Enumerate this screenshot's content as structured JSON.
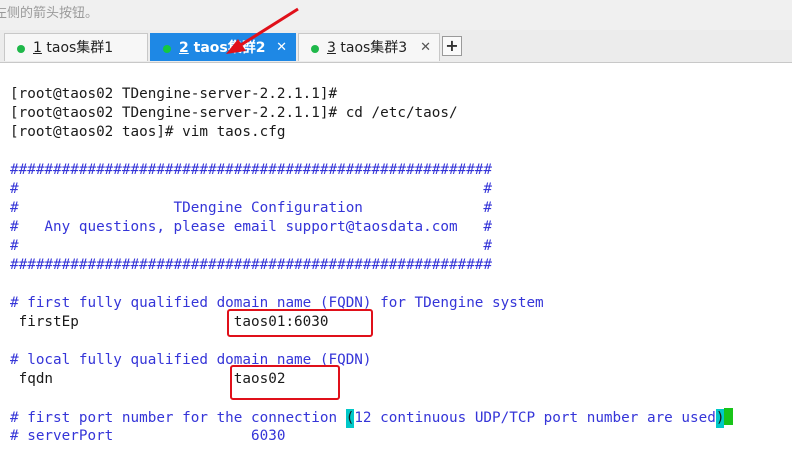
{
  "hint": {
    "text": "左侧的箭头按钮。"
  },
  "tabs": [
    {
      "number": "1",
      "name": " taos集群1",
      "close": "✕",
      "active": false
    },
    {
      "number": "2",
      "name": " taos集群2",
      "close": "✕",
      "active": true
    },
    {
      "number": "3",
      "name": " taos集群3",
      "close": "✕",
      "active": false
    }
  ],
  "add_tab": "+",
  "colors": {
    "active_tab": "#1e88e5",
    "status_dot": "#1fb84a",
    "comment": "#3535d8",
    "highlight_box": "#e0101a",
    "cursor": "#00c8c8",
    "green_cursor": "#19c419"
  },
  "icons": [
    "status-dot-icon",
    "close-icon",
    "plus-icon",
    "arrow-annotation-icon"
  ],
  "terminal": {
    "lines": [
      {
        "text": "[root@taos02 TDengine-server-2.2.1.1]#",
        "style": "prompt"
      },
      {
        "text": "[root@taos02 TDengine-server-2.2.1.1]# cd /etc/taos/",
        "style": "prompt"
      },
      {
        "text": "[root@taos02 taos]# vim taos.cfg",
        "style": "prompt"
      },
      {
        "text": "",
        "style": "prompt"
      },
      {
        "text": "########################################################",
        "style": "cmt"
      },
      {
        "text": "#                                                      #",
        "style": "cmt"
      },
      {
        "text": "#                  TDengine Configuration              #",
        "style": "cmt"
      },
      {
        "text": "#   Any questions, please email support@taosdata.com   #",
        "style": "cmt"
      },
      {
        "text": "#                                                      #",
        "style": "cmt"
      },
      {
        "text": "########################################################",
        "style": "cmt"
      },
      {
        "text": "",
        "style": "cmt"
      },
      {
        "text": "# first fully qualified domain name (FQDN) for TDengine system",
        "style": "cmt"
      },
      {
        "text": " firstEp                  taos01:6030",
        "style": "cfg"
      },
      {
        "text": "",
        "style": "cfg"
      },
      {
        "text": "# local fully qualified domain name (FQDN)",
        "style": "cmt"
      },
      {
        "text": " fqdn                     taos02",
        "style": "cfg"
      },
      {
        "text": "",
        "style": "cfg"
      },
      {
        "text_before": "# first port number for the connection ",
        "cursor_char": "(",
        "text_after": "12 continuous UDP/TCP port number are used",
        "end_char": ")",
        "style": "cmt"
      },
      {
        "text": "# serverPort                6030",
        "style": "cmt"
      }
    ]
  }
}
